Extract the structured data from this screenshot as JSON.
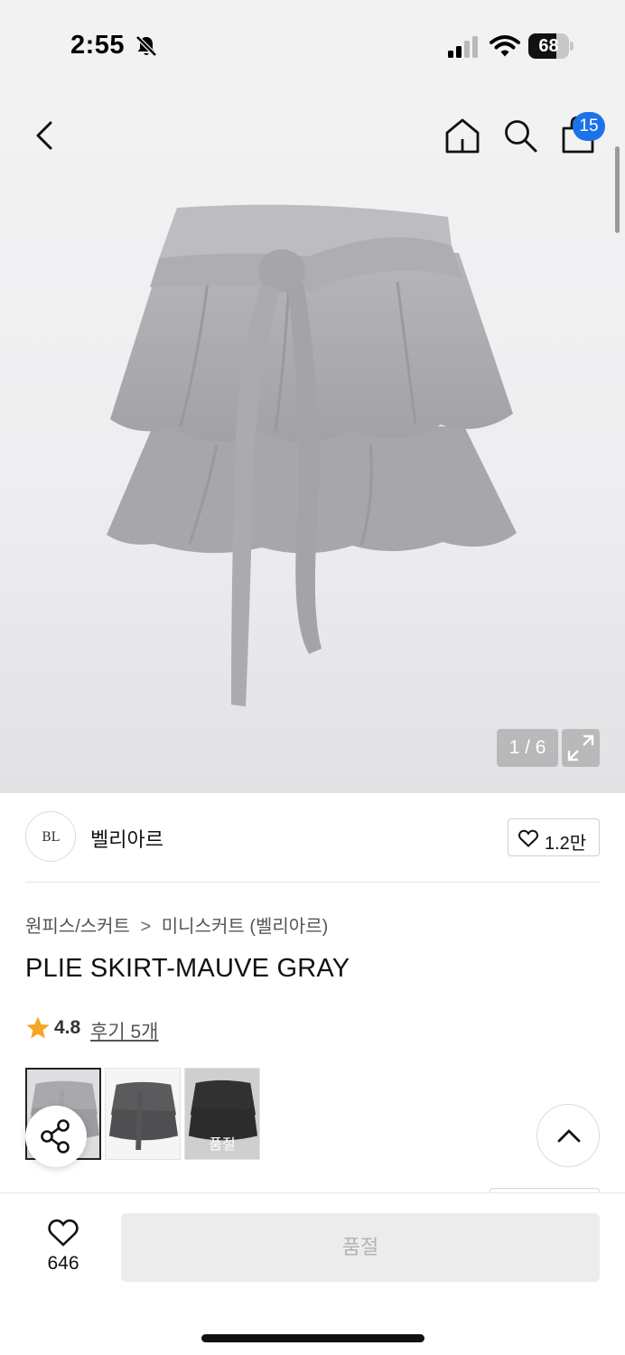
{
  "status_bar": {
    "time": "2:55",
    "battery": "68",
    "battery_level": 0.68,
    "icons": [
      "bell-off-icon",
      "cellular-signal-icon",
      "wifi-icon",
      "battery-icon"
    ]
  },
  "nav": {
    "cart_count": "15",
    "icons": [
      "back-chevron-icon",
      "home-icon",
      "search-icon",
      "shopping-bag-icon"
    ]
  },
  "gallery": {
    "page_counter": "1 / 6",
    "icons": [
      "expand-icon"
    ]
  },
  "brand": {
    "logo_text": "BL",
    "name": "벨리아르",
    "like_count": "1.2만"
  },
  "breadcrumb": {
    "category": "원피스/스커트",
    "separator": ">",
    "subcategory": "미니스커트 (벨리아르)"
  },
  "product": {
    "title": "PLIE SKIRT-MAUVE GRAY",
    "rating": "4.8",
    "review_link": "후기 5개",
    "colors": {
      "mauve_gray": "#a9a9ad",
      "charcoal": "#5b5a5c",
      "black": "#151515"
    }
  },
  "thumbnails": [
    {
      "soldout_label": ""
    },
    {
      "soldout_label": ""
    },
    {
      "soldout_label": "품절"
    }
  ],
  "bottom_bar": {
    "wish_count": "646",
    "cta_label": "품절"
  }
}
